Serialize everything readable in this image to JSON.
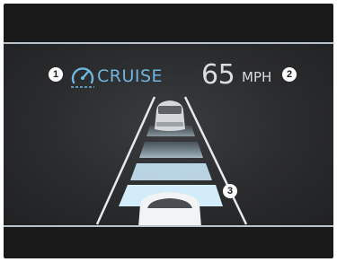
{
  "cluster": {
    "cruise": {
      "label": "CRUISE",
      "icon": "cruise-control-icon",
      "color": "#6fb6e0"
    },
    "speed": {
      "value": "65",
      "unit": "MPH"
    },
    "markers": [
      "1",
      "2",
      "3"
    ],
    "distance_bars": 4,
    "colors": {
      "accent": "#6fb6e0",
      "text": "#d9dde0",
      "background": "#1a1a1a",
      "bar": "#c9e6f5"
    }
  }
}
